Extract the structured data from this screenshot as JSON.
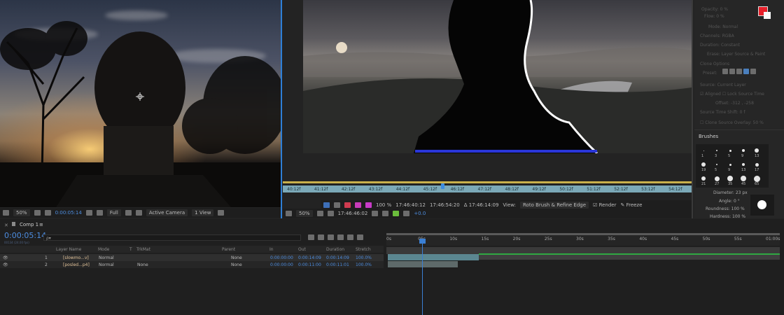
{
  "comp_viewer": {
    "zoom": "50%",
    "timecode": "0:00:05:14",
    "resolution": "Full",
    "camera": "Active Camera",
    "views": "1 View",
    "exposure": "+0.0"
  },
  "layer_viewer": {
    "ruler_ticks": [
      "40:12f",
      "41:12f",
      "42:12f",
      "43:12f",
      "44:12f",
      "45:12f",
      "46:12f",
      "47:12f",
      "48:12f",
      "49:12f",
      "50:12f",
      "51:12f",
      "52:12f",
      "53:12f",
      "54:12f"
    ],
    "zoom_small": "100 %",
    "time_in": "17:46:40:12",
    "time_out": "17:46:54:20",
    "duration": "Δ 17:46:14:09",
    "view_label": "View:",
    "view_value": "Roto Brush & Refine Edge",
    "render_label": "Render",
    "freeze_label": "Freeze",
    "zoom": "50%",
    "timecode": "17:46:46:02",
    "exposure": "+0.0"
  },
  "right_panel": {
    "opacity": "Opacity: 0 %",
    "flow": "Flow: 0 %",
    "mode_label": "Mode:",
    "mode_value": "Normal",
    "channels_label": "Channels:",
    "channels_value": "RGBA",
    "duration_label": "Duration:",
    "duration_value": "Constant",
    "erase_label": "Erase:",
    "erase_value": "Layer Source & Paint",
    "clone_options": "Clone Options",
    "preset_label": "Preset:",
    "source_label": "Source:",
    "source_value": "Current Layer",
    "aligned": "Aligned",
    "lock_source": "Lock Source Time",
    "offset": "Offset: -312 , -258",
    "source_time_shift": "Source Time Shift: 0 f",
    "clone_overlay": "Clone Source Overlay: 50 %",
    "brushes_title": "Brushes",
    "brush_sizes": [
      "1",
      "3",
      "5",
      "9",
      "13",
      "19",
      "5",
      "9",
      "13",
      "17",
      "21",
      "27",
      "35",
      "45",
      "65"
    ],
    "diameter": "Diameter: 23 px",
    "angle": "Angle: 0 °",
    "roundness": "Roundness: 100 %",
    "hardness": "Hardness: 100 %"
  },
  "timeline": {
    "comp_tab": "Comp 1",
    "current_time": "0:00:05:14",
    "sub_time": "00134 (24.00 fps)",
    "search_placeholder": "ρ▾",
    "columns": {
      "layer_name": "Layer Name",
      "mode": "Mode",
      "t": "T",
      "trkmat": "TrkMat",
      "parent": "Parent",
      "in": "In",
      "out": "Out",
      "duration": "Duration",
      "stretch": "Stretch"
    },
    "ruler": [
      "0s",
      "05s",
      "10s",
      "15s",
      "20s",
      "25s",
      "30s",
      "35s",
      "40s",
      "45s",
      "50s",
      "55s",
      "01:00s"
    ],
    "layers": [
      {
        "num": "1",
        "name": "[slowmo...v]",
        "mode": "Normal",
        "trkmat": "",
        "parent": "None",
        "in": "0:00:00:00",
        "out": "0:00:14:09",
        "duration": "0:00:14:09",
        "stretch": "100.0%"
      },
      {
        "num": "2",
        "name": "[posled...p4]",
        "mode": "Normal",
        "trkmat": "None",
        "parent": "None",
        "in": "0:00:00:00",
        "out": "0:00:11:00",
        "duration": "0:00:11:01",
        "stretch": "100.0%"
      }
    ]
  }
}
